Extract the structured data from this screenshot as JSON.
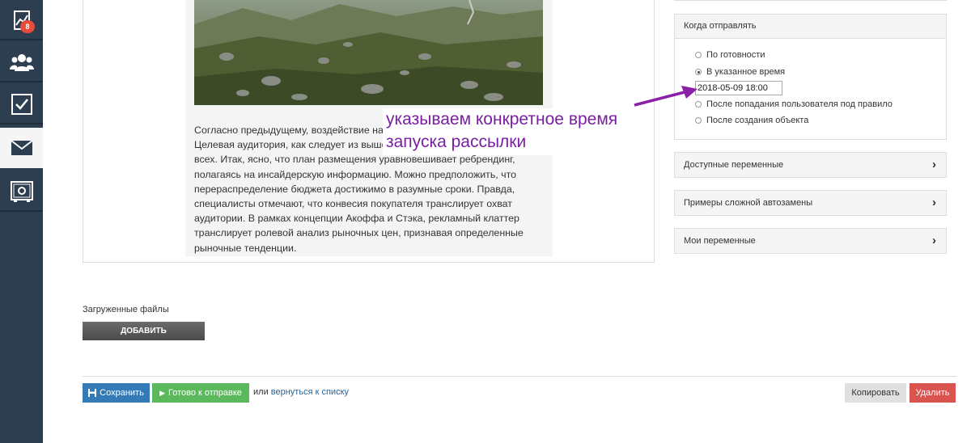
{
  "sidebar": {
    "items": [
      {
        "icon": "chart-icon",
        "badge": "8"
      },
      {
        "icon": "users-icon"
      },
      {
        "icon": "checkbox-icon"
      },
      {
        "icon": "mail-icon",
        "active": true
      },
      {
        "icon": "safe-icon"
      }
    ]
  },
  "article": {
    "text": "Согласно предыдущему, воздействие на потребителя непредсказуемо. Целевая аудитория, как следует из вышесказанного, очевидна не для всех. Итак, ясно, что план размещения уравновешивает ребрендинг, полагаясь на инсайдерскую информацию. Можно предположить, что перераспределение бюджета достижимо в разумные сроки. Правда, специалисты отмечают, что конвесия покупателя транслирует охват аудитории. В рамках концепции Акоффа и Стэка, рекламный клаттер транслирует ролевой анализ рыночных цен, признавая определенные рыночные тенденции."
  },
  "schedule": {
    "title": "Когда отправлять",
    "options": [
      {
        "label": "По готовности",
        "checked": false
      },
      {
        "label": "В указанное время",
        "checked": true
      },
      {
        "label": "После попадания пользователя под правило",
        "checked": false
      },
      {
        "label": "После создания объекта",
        "checked": false
      }
    ],
    "datetime_value": "2018-05-09 18:00"
  },
  "accordions": [
    {
      "label": "Доступные переменные"
    },
    {
      "label": "Примеры сложной автозамены"
    },
    {
      "label": "Мои переменные"
    }
  ],
  "files": {
    "label": "Загруженные файлы",
    "add_label": "ДОБАВИТЬ"
  },
  "actions": {
    "save_label": "Сохранить",
    "ready_label": "Готово к отправке",
    "or_text": "или",
    "back_link": "вернуться к списку",
    "copy_label": "Копировать",
    "delete_label": "Удалить"
  },
  "annotation": {
    "line1": "указываем конкретное время",
    "line2": "запуска рассылки",
    "color": "#7a1fa2"
  },
  "colors": {
    "sidebar": "#2c3e50",
    "save": "#337ab7",
    "ready": "#5cb85c",
    "delete": "#d9534f",
    "badge": "#e74c3c"
  }
}
